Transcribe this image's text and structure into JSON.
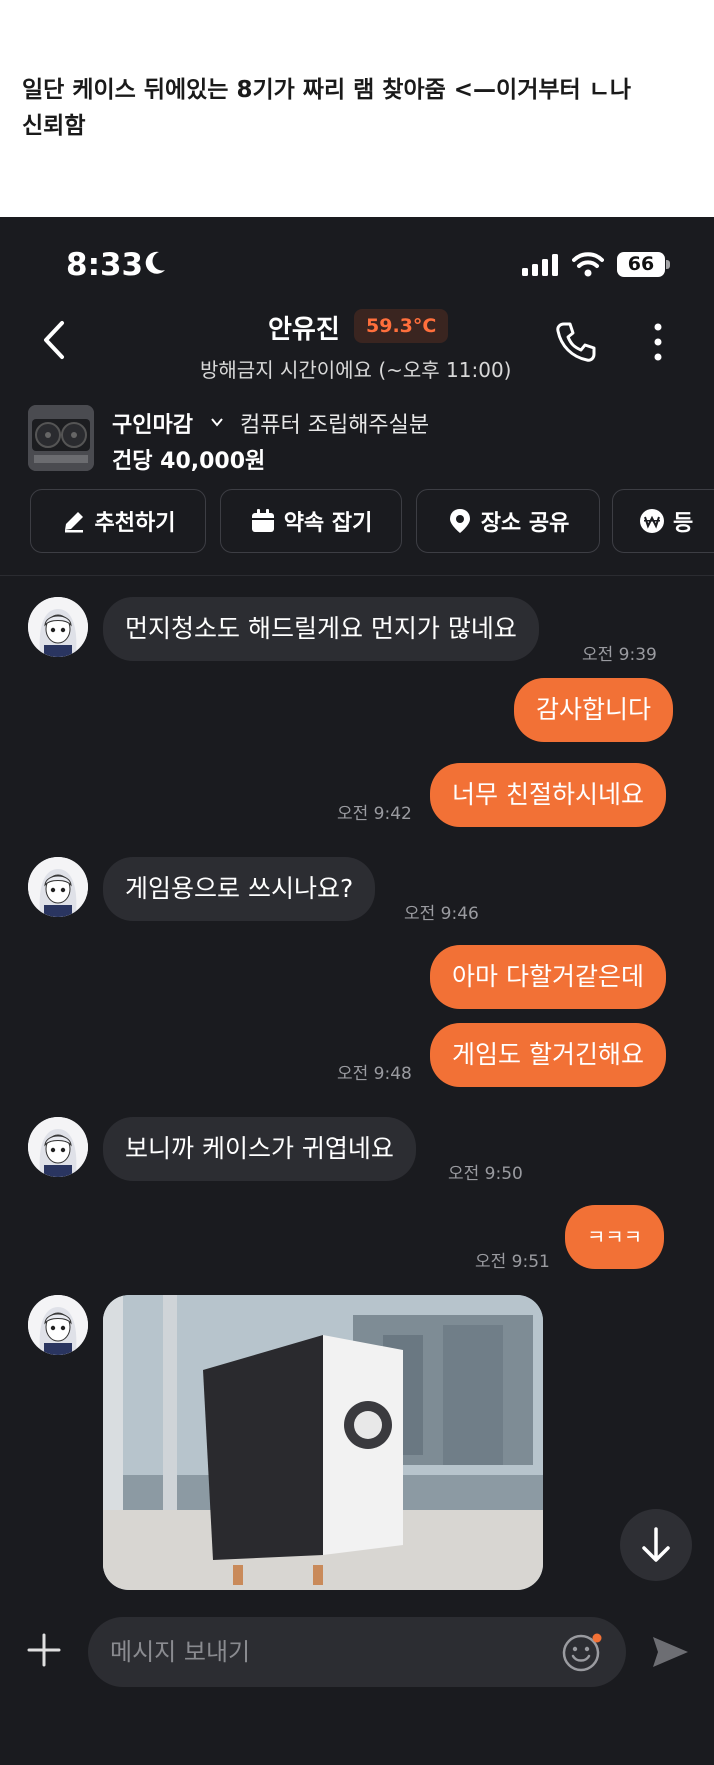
{
  "caption": {
    "line1": "일단 케이스 뒤에있는 8기가 짜리 램 찾아줌 <—이거부터 ㄴ나",
    "line2": "신뢰함"
  },
  "status_bar": {
    "time": "8:33",
    "battery": "66"
  },
  "header": {
    "name": "안유진",
    "temperature": "59.3°C",
    "dnd_notice": "방해금지 시간이에요 (~오후 11:00)"
  },
  "product": {
    "status": "구인마감",
    "title": "컴퓨터 조립해주실분",
    "price": "건당 40,000원"
  },
  "actions": [
    {
      "label": "추천하기",
      "icon": "pencil-icon"
    },
    {
      "label": "약속 잡기",
      "icon": "calendar-icon"
    },
    {
      "label": "장소 공유",
      "icon": "location-pin-icon"
    },
    {
      "label": "등",
      "icon": "won-icon"
    }
  ],
  "messages": [
    {
      "dir": "in",
      "text": "먼지청소도 해드릴게요 먼지가 많네요",
      "time": "오전 9:39"
    },
    {
      "dir": "out",
      "text": "감사합니다",
      "time": ""
    },
    {
      "dir": "out",
      "text": "너무 친절하시네요",
      "time": "오전 9:42"
    },
    {
      "dir": "in",
      "text": "게임용으로 쓰시나요?",
      "time": "오전 9:46"
    },
    {
      "dir": "out",
      "text": "아마 다할거같은데",
      "time": ""
    },
    {
      "dir": "out",
      "text": "게임도 할거긴해요",
      "time": "오전 9:48"
    },
    {
      "dir": "in",
      "text": "보니까 케이스가 귀엽네요",
      "time": "오전 9:50"
    },
    {
      "dir": "out",
      "text": "ㅋㅋㅋ",
      "time": "오전 9:51"
    }
  ],
  "input": {
    "placeholder": "메시지 보내기"
  },
  "colors": {
    "accent": "#f27136",
    "background": "#1a1b1f",
    "incoming_bubble": "#2c2d32",
    "temperature": "#ff6f3c"
  }
}
